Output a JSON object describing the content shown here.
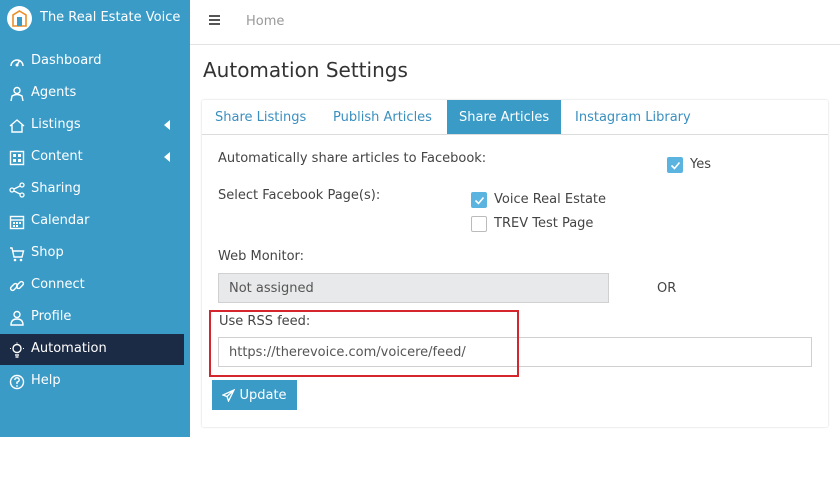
{
  "brand": {
    "name": "The Real Estate Voice",
    "logo_icon": "house-logo-icon"
  },
  "sidebar": {
    "items": [
      {
        "label": "Dashboard",
        "icon": "dashboard-icon",
        "has_submenu": false,
        "active": false
      },
      {
        "label": "Agents",
        "icon": "agent-icon",
        "has_submenu": false,
        "active": false
      },
      {
        "label": "Listings",
        "icon": "house-icon",
        "has_submenu": true,
        "active": false
      },
      {
        "label": "Content",
        "icon": "content-icon",
        "has_submenu": true,
        "active": false
      },
      {
        "label": "Sharing",
        "icon": "share-icon",
        "has_submenu": false,
        "active": false
      },
      {
        "label": "Calendar",
        "icon": "calendar-icon",
        "has_submenu": false,
        "active": false
      },
      {
        "label": "Shop",
        "icon": "cart-icon",
        "has_submenu": false,
        "active": false
      },
      {
        "label": "Connect",
        "icon": "link-icon",
        "has_submenu": false,
        "active": false
      },
      {
        "label": "Profile",
        "icon": "user-icon",
        "has_submenu": false,
        "active": false
      },
      {
        "label": "Automation",
        "icon": "bulb-gear-icon",
        "has_submenu": false,
        "active": true
      },
      {
        "label": "Help",
        "icon": "help-icon",
        "has_submenu": false,
        "active": false
      }
    ]
  },
  "topbar": {
    "breadcrumb": "Home",
    "menu_icon": "hamburger-icon"
  },
  "page": {
    "title": "Automation Settings"
  },
  "tabs": [
    {
      "label": "Share Listings",
      "active": false
    },
    {
      "label": "Publish Articles",
      "active": false
    },
    {
      "label": "Share Articles",
      "active": true
    },
    {
      "label": "Instagram Library",
      "active": false
    }
  ],
  "form": {
    "auto_share_label": "Automatically share articles to Facebook:",
    "auto_share_option": {
      "label": "Yes",
      "checked": true
    },
    "select_pages_label": "Select Facebook Page(s):",
    "pages": [
      {
        "label": "Voice Real Estate",
        "checked": true
      },
      {
        "label": "TREV Test Page",
        "checked": false
      }
    ],
    "web_monitor_label": "Web Monitor:",
    "web_monitor_value": "Not assigned",
    "or_text": "OR",
    "rss_label": "Use RSS feed:",
    "rss_value": "https://therevoice.com/voicere/feed/",
    "update_button": "Update"
  },
  "colors": {
    "sidebar": "#3a9bc7",
    "active_nav": "#1c2b45",
    "accent": "#3a9bc7",
    "highlight": "#d6262d"
  }
}
